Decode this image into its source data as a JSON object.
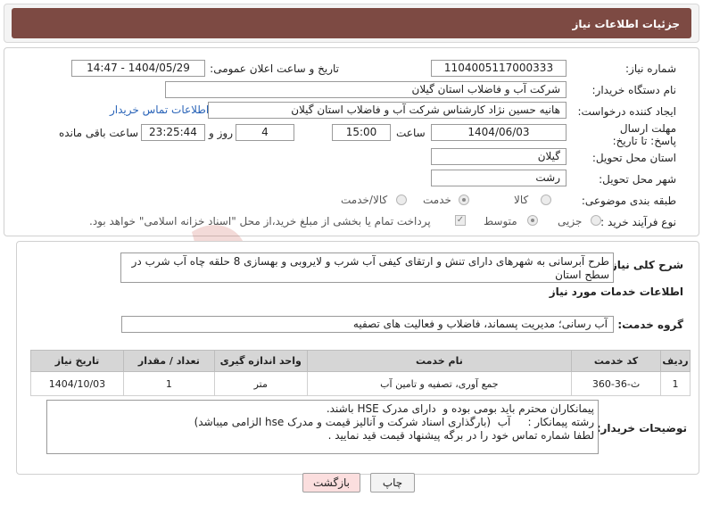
{
  "header": {
    "title": "جزئیات اطلاعات نیاز"
  },
  "labels": {
    "need_number": "شماره نیاز:",
    "announce_datetime": "تاریخ و ساعت اعلان عمومی:",
    "buyer_org": "نام دستگاه خریدار:",
    "requester": "ایجاد کننده درخواست:",
    "deadline": "مهلت ارسال پاسخ: تا تاریخ:",
    "time": "ساعت",
    "day_and": "روز و",
    "remaining": "ساعت باقی مانده",
    "province": "استان محل تحویل:",
    "city": "شهر محل تحویل:",
    "category": "طبقه بندی موضوعی:",
    "process_type": "نوع فرآیند خرید :",
    "general_desc": "شرح کلی نیاز:",
    "services_info": "اطلاعات خدمات مورد نیاز",
    "service_group": "گروه خدمت:",
    "buyer_notes": "توضیحات خریدار:"
  },
  "values": {
    "need_number": "1104005117000333",
    "announce_datetime": "1404/05/29 - 14:47",
    "buyer_org": "شرکت آب و فاضلاب استان گیلان",
    "requester": "هانیه حسین نژاد کارشناس شرکت آب و فاضلاب استان گیلان",
    "contact_link": "اطلاعات تماس خریدار",
    "deadline_date": "1404/06/03",
    "deadline_time": "15:00",
    "days": "4",
    "remaining_time": "23:25:44",
    "province": "گیلان",
    "city": "رشت",
    "general_desc": "طرح آبرسانی به شهرهای دارای تنش و ارتقای کیفی آب شرب و لایروبی و بهسازی 8 حلقه چاه آب شرب در سطح استان",
    "service_group": "آب رسانی؛ مدیریت پسماند، فاضلاب و فعالیت های تصفیه",
    "buyer_notes": "پیمانکاران محترم باید بومی بوده و  دارای مدرک HSE باشند.\nرشته پیمانکار :     آب  (بارگذاری اسناد شرکت و آنالیز قیمت و مدرک hse الزامی میباشد)\nلطفا شماره تماس خود را در برگه پیشنهاد قیمت قید نمایید ."
  },
  "category_options": [
    {
      "label": "کالا",
      "checked": false
    },
    {
      "label": "خدمت",
      "checked": true
    },
    {
      "label": "کالا/خدمت",
      "checked": false
    }
  ],
  "process_options": [
    {
      "label": "جزیی",
      "checked": false
    },
    {
      "label": "متوسط",
      "checked": true
    }
  ],
  "payment_note": "پرداخت تمام یا بخشی از مبلغ خرید،از محل \"اسناد خزانه اسلامی\" خواهد بود.",
  "table": {
    "headers": [
      "ردیف",
      "کد خدمت",
      "نام خدمت",
      "واحد اندازه گیری",
      "تعداد / مقدار",
      "تاریخ نیاز"
    ],
    "rows": [
      [
        "1",
        "ث-36-360",
        "جمع آوری، تصفیه و تامین آب",
        "متر",
        "1",
        "1404/10/03"
      ]
    ]
  },
  "buttons": {
    "print": "چاپ",
    "back": "بازگشت"
  },
  "watermark": "AriaTender.neT",
  "colors": {
    "header": "#7d4a43",
    "link": "#2a64b8",
    "back_button": "#fbdede"
  }
}
